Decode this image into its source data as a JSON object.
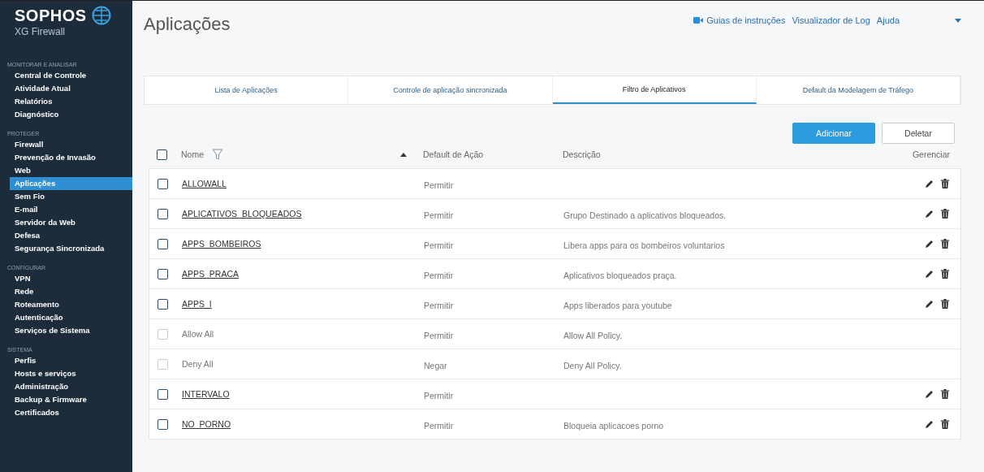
{
  "brand": {
    "name": "SOPHOS",
    "product": "XG Firewall"
  },
  "sidebar": {
    "sections": [
      {
        "title": "MONITORAR E ANALISAR",
        "items": [
          {
            "label": "Central de Controle",
            "selected": false
          },
          {
            "label": "Atividade Atual",
            "selected": false
          },
          {
            "label": "Relatórios",
            "selected": false
          },
          {
            "label": "Diagnóstico",
            "selected": false
          }
        ]
      },
      {
        "title": "PROTEGER",
        "items": [
          {
            "label": "Firewall",
            "selected": false
          },
          {
            "label": "Prevenção de Invasão",
            "selected": false
          },
          {
            "label": "Web",
            "selected": false
          },
          {
            "label": "Aplicações",
            "selected": true
          },
          {
            "label": "Sem Fio",
            "selected": false
          },
          {
            "label": "E-mail",
            "selected": false
          },
          {
            "label": "Servidor da Web",
            "selected": false
          },
          {
            "label": "Defesa",
            "selected": false
          },
          {
            "label": "Segurança Sincronizada",
            "selected": false
          }
        ]
      },
      {
        "title": "CONFIGURAR",
        "items": [
          {
            "label": "VPN",
            "selected": false
          },
          {
            "label": "Rede",
            "selected": false
          },
          {
            "label": "Roteamento",
            "selected": false
          },
          {
            "label": "Autenticação",
            "selected": false
          },
          {
            "label": "Serviços de Sistema",
            "selected": false
          }
        ]
      },
      {
        "title": "SISTEMA",
        "items": [
          {
            "label": "Perfis",
            "selected": false
          },
          {
            "label": "Hosts e serviços",
            "selected": false
          },
          {
            "label": "Administração",
            "selected": false
          },
          {
            "label": "Backup & Firmware",
            "selected": false
          },
          {
            "label": "Certificados",
            "selected": false
          }
        ]
      }
    ]
  },
  "page_title": "Aplicações",
  "top_links": [
    "Guias de instruções",
    "Visualizador de Log",
    "Ajuda"
  ],
  "tabs": [
    {
      "label": "Lista de Aplicações",
      "selected": false
    },
    {
      "label": "Controle de aplicação sincronizada",
      "selected": false
    },
    {
      "label": "Filtro de Aplicativos",
      "selected": true
    },
    {
      "label": "Default da Modelagem de Tráfego",
      "selected": false
    }
  ],
  "buttons": {
    "add": "Adicionar",
    "delete": "Deletar"
  },
  "table": {
    "all_checked": false,
    "columns": [
      "Nome",
      "Default de Ação",
      "Descrição",
      "Gerenciar"
    ],
    "rows": [
      {
        "name": "ALLOWALL",
        "action": "Permitir",
        "disabled": false
      },
      {
        "name": "APLICATIVOS_BLOQUEADOS",
        "action": "Permitir",
        "description": "Grupo Destinado a aplicativos bloqueados.",
        "disabled": false
      },
      {
        "name": "APPS_BOMBEIROS",
        "action": "Permitir",
        "description": "Libera apps para os bombeiros voluntarios",
        "disabled": false
      },
      {
        "name": "APPS_PRACA",
        "action": "Permitir",
        "description": "Aplicativos bloqueados praça.",
        "disabled": false
      },
      {
        "name": "APPS_I",
        "action": "Permitir",
        "description": "Apps liberados para youtube",
        "disabled": false
      },
      {
        "name": "Allow All",
        "action": "Permitir",
        "description": "Allow All Policy.",
        "disabled": true
      },
      {
        "name": "Deny All",
        "action": "Negar",
        "description": "Deny All Policy.",
        "disabled": true
      },
      {
        "name": "INTERVALO",
        "action": "Permitir",
        "disabled": false
      },
      {
        "name": "NO_PORNO",
        "action": "Permitir",
        "description": "Bloqueia aplicacoes porno",
        "disabled": false
      }
    ]
  }
}
